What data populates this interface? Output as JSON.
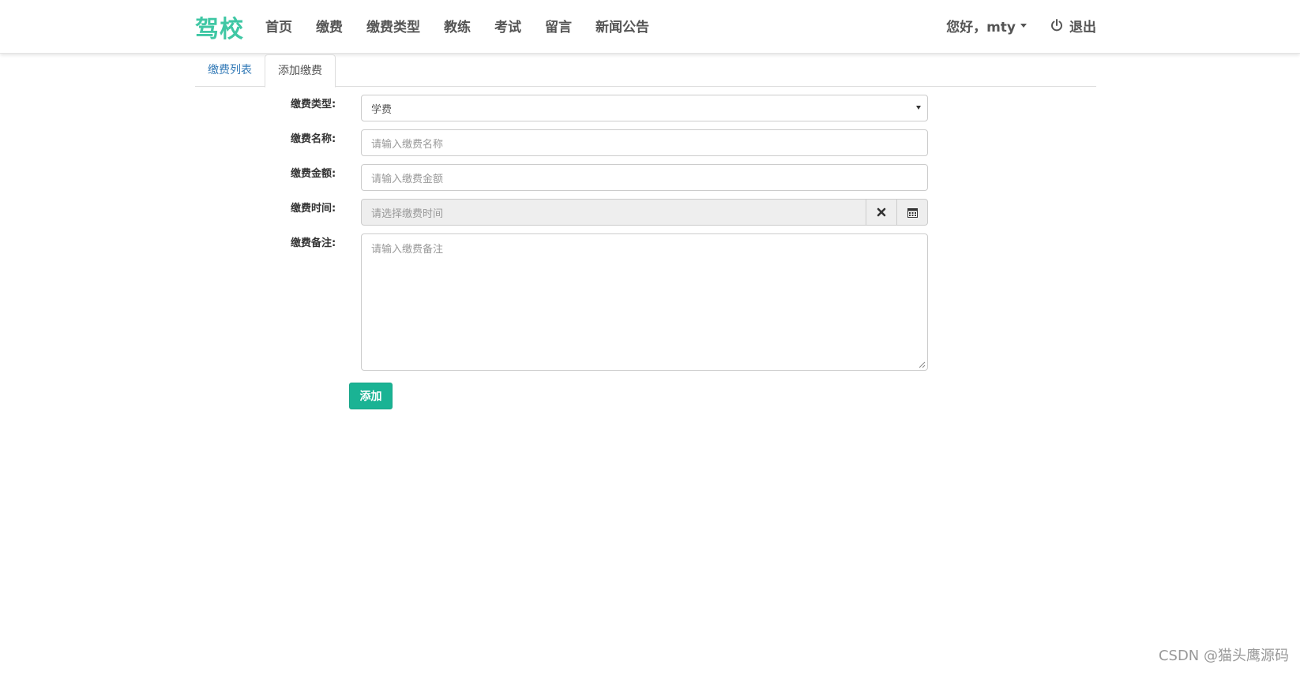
{
  "navbar": {
    "brand": "驾校",
    "links": [
      "首页",
      "缴费",
      "缴费类型",
      "教练",
      "考试",
      "留言",
      "新闻公告"
    ],
    "greeting": "您好，mty",
    "logout_label": "退出"
  },
  "tabs": [
    {
      "label": "缴费列表",
      "active": false
    },
    {
      "label": "添加缴费",
      "active": true
    }
  ],
  "form": {
    "type": {
      "label": "缴费类型:",
      "value": "学费"
    },
    "name": {
      "label": "缴费名称:",
      "placeholder": "请输入缴费名称"
    },
    "amount": {
      "label": "缴费金额:",
      "placeholder": "请输入缴费金额"
    },
    "time": {
      "label": "缴费时间:",
      "placeholder": "请选择缴费时间"
    },
    "remark": {
      "label": "缴费备注:",
      "placeholder": "请输入缴费备注"
    },
    "submit_label": "添加"
  },
  "watermark": "CSDN @猫头鹰源码",
  "colors": {
    "brand": "#3fc7a4",
    "primary_button": "#1ab394",
    "tab_link": "#337ab7"
  }
}
